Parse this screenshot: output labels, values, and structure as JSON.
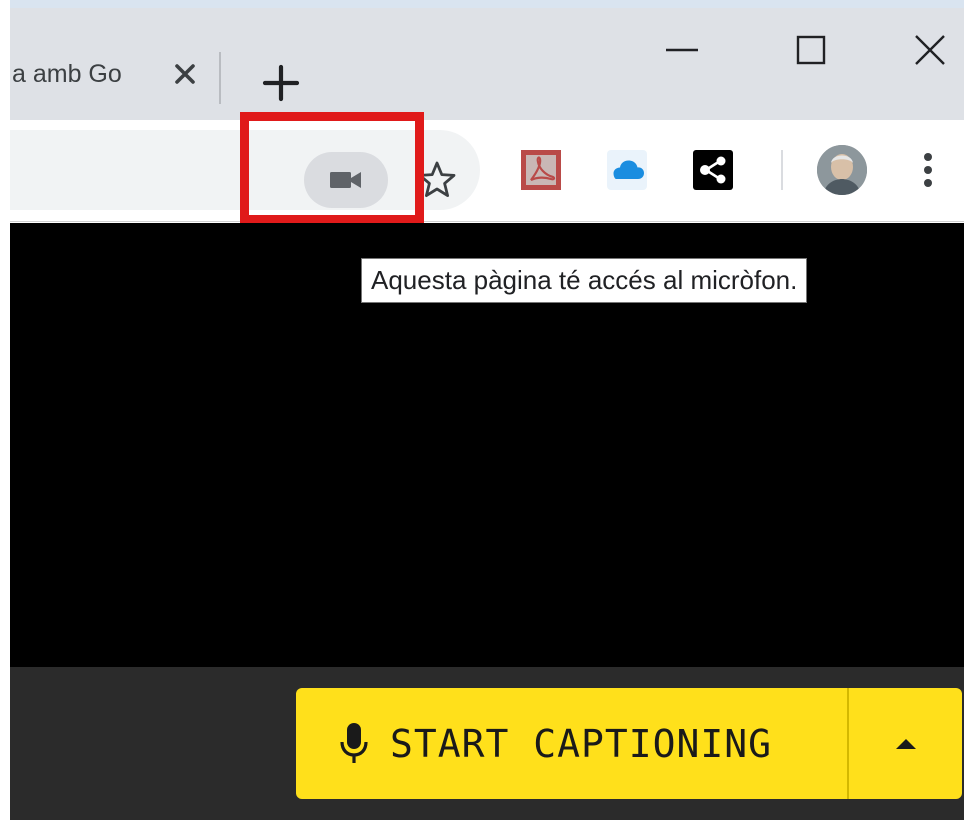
{
  "browser": {
    "tab": {
      "title": "a amb Go",
      "close_icon": "close-icon"
    },
    "new_tab_icon": "plus-icon",
    "window_controls": [
      "minimize-icon",
      "maximize-icon",
      "close-icon"
    ],
    "address_bar": {
      "camera_indicator_icon": "video-camera-icon",
      "bookmark_icon": "star-icon"
    },
    "extensions": [
      "pdf-icon",
      "cloud-icon",
      "share-icon"
    ],
    "menu_icon": "more-vert-icon"
  },
  "tooltip": {
    "text": "Aquesta pàgina té accés al micròfon."
  },
  "caption_bar": {
    "start_label": "START CAPTIONING",
    "mic_icon": "microphone-icon",
    "toggle_icon": "caret-up-icon"
  },
  "colors": {
    "highlight": "#e01a1a",
    "caption_button": "#ffe01b",
    "content_background": "#000000"
  }
}
